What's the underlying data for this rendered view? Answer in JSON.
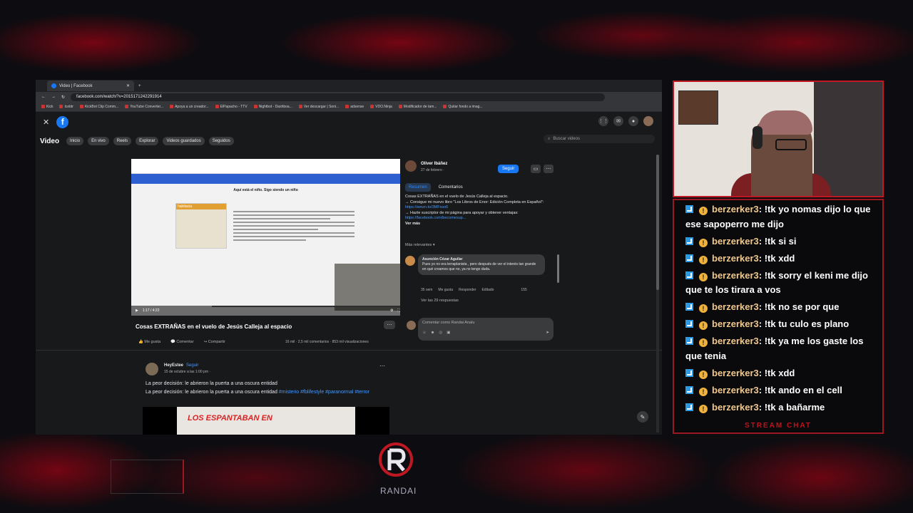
{
  "browser": {
    "tab_title": "Video | Facebook",
    "url": "facebook.com/watch/?v=2015171242291914",
    "bookmarks": [
      "Kick",
      "Icebtr",
      "KickBot Clip Comm...",
      "YouTube Converter...",
      "Apoya a un creador...",
      "ElPapacho - TTV",
      "Nightbot - Dashboa...",
      "Ver descargar | Soni...",
      "adsense",
      "VDO.Ninja",
      "Modificador de tam...",
      "Quitar fondo a imag..."
    ]
  },
  "fb": {
    "nav_title": "Video",
    "nav_items": [
      "Inicio",
      "En vivo",
      "Reels",
      "Explorar",
      "Videos guardados",
      "Seguidos"
    ],
    "search_placeholder": "Buscar videos",
    "player": {
      "article_quote": "Aquí está el niño. Sigo siendo un niño",
      "timestamp": "1:17 / 4:22",
      "progress": 0.3
    },
    "video_title": "Cosas EXTRAÑAS en el vuelo de Jesús Calleja al espacio",
    "actions": [
      "Me gusta",
      "Comentar",
      "Compartir"
    ],
    "stats": "16 mil · 2,5 mil comentarios · 853 mil visualizaciones",
    "channel": {
      "name": "Oliver Ibáñez",
      "date": "27 de febrero · ",
      "follow_label": "Seguir"
    },
    "tabs": [
      "Resumen",
      "Comentarios"
    ],
    "description": {
      "line1": "Cosas EXTRAÑAS en el vuelo de Jesús Calleja al espacio.",
      "line2": "→ Consigue mi nuevo libro \"Los Libros de Enor: Edición Completa en Español\": ",
      "link1": "https://amzn.to/3MFsso6",
      "line3": "→ Hazte suscriptor de mi página para apoyar y obtener ventajas: ",
      "link2": "https://facebook.com/becomesup...",
      "more": "Ver más"
    },
    "most_relevant": "Más relevantes ▾",
    "comment": {
      "author": "Asunción Cózar Aguilar",
      "text": "Pues yo no era terraplanista , pero después de ver el interés tan grande en qué creamos que no, ya no tengo duda.",
      "time": "35 sem",
      "like": "Me gusta",
      "reply": "Responder",
      "edited": "Editado",
      "reactions": "155",
      "view_replies": "Ver las 29 respuestas"
    },
    "compose_placeholder": "Comentar como Randai Analu",
    "post": {
      "author": "HeyEstee",
      "follow": "Seguir",
      "date": "15 de octubre a las 1:00 pm · ",
      "title": "La peor decisión: le abrieron la puerta a una oscura entidad",
      "text": "La peor decisión: le abrieron la puerta a una oscura entidad ",
      "tags": "#misterio #fblifestyle #paranormal #terror",
      "thumb_caption": "LOS ESPANTABAN EN"
    }
  },
  "chat": {
    "messages": [
      {
        "user": "berzerker3",
        "text": ": !tk yo nomas dijo lo que ese sapoperro me dijo"
      },
      {
        "user": "berzerker3",
        "text": ": !tk si si"
      },
      {
        "user": "berzerker3",
        "text": ": !tk xdd"
      },
      {
        "user": "berzerker3",
        "text": ": !tk sorry el keni me dijo que te los tirara a vos"
      },
      {
        "user": "berzerker3",
        "text": ": !tk no se por que"
      },
      {
        "user": "berzerker3",
        "text": ": !tk tu culo es plano"
      },
      {
        "user": "berzerker3",
        "text": ": !tk ya me los gaste los que tenia"
      },
      {
        "user": "berzerker3",
        "text": ": !tk xdd"
      },
      {
        "user": "berzerker3",
        "text": ": !tk ando en el cell"
      },
      {
        "user": "berzerker3",
        "text": ": !tk a bañarme"
      }
    ],
    "footer": "STREAM CHAT"
  },
  "overlay": {
    "logo_text": "RANDAI",
    "accent": "#c01822"
  }
}
